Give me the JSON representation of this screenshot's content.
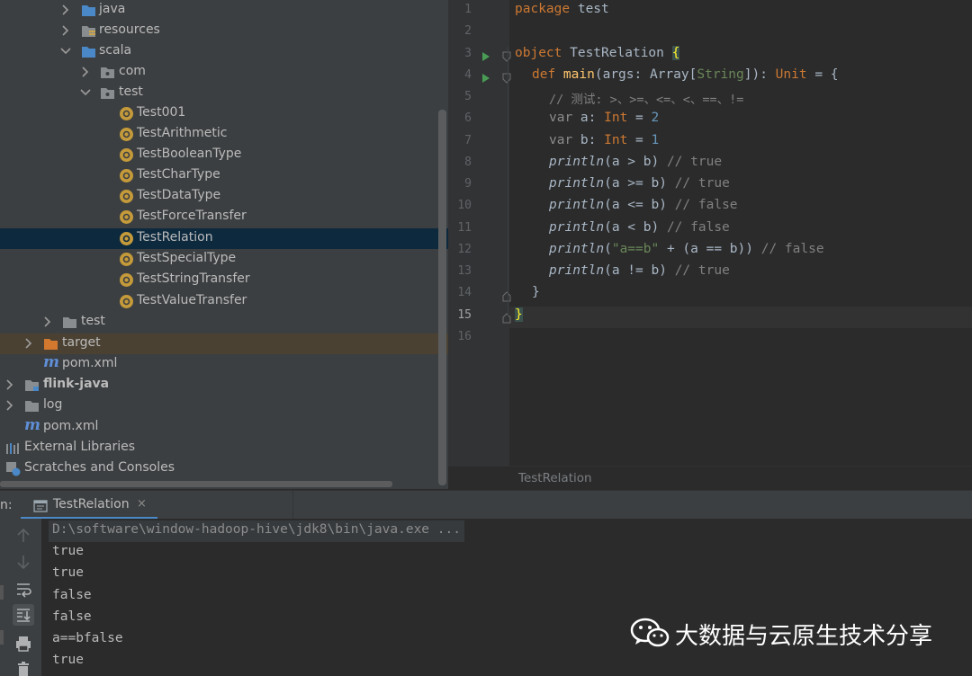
{
  "project_tree": {
    "items": [
      {
        "label": "java",
        "icon": "folder-icon"
      },
      {
        "label": "resources",
        "icon": "resources-folder-icon"
      },
      {
        "label": "scala",
        "icon": "source-folder-icon"
      },
      {
        "label": "com",
        "icon": "package-icon"
      },
      {
        "label": "test",
        "icon": "package-icon"
      },
      {
        "label": "Test001",
        "icon": "scala-object-icon"
      },
      {
        "label": "TestArithmetic",
        "icon": "scala-object-icon"
      },
      {
        "label": "TestBooleanType",
        "icon": "scala-object-icon"
      },
      {
        "label": "TestCharType",
        "icon": "scala-object-icon"
      },
      {
        "label": "TestDataType",
        "icon": "scala-object-icon"
      },
      {
        "label": "TestForceTransfer",
        "icon": "scala-object-icon"
      },
      {
        "label": "TestRelation",
        "icon": "scala-object-icon",
        "selected": true
      },
      {
        "label": "TestSpecialType",
        "icon": "scala-object-icon"
      },
      {
        "label": "TestStringTransfer",
        "icon": "scala-object-icon"
      },
      {
        "label": "TestValueTransfer",
        "icon": "scala-object-icon"
      },
      {
        "label": "test",
        "icon": "folder-icon"
      },
      {
        "label": "target",
        "icon": "excluded-folder-icon"
      },
      {
        "label": "pom.xml",
        "icon": "maven-icon",
        "glyph": "m"
      },
      {
        "label": "flink-java",
        "icon": "module-folder-icon"
      },
      {
        "label": "log",
        "icon": "folder-icon"
      },
      {
        "label": "pom.xml",
        "icon": "maven-icon",
        "glyph": "m"
      },
      {
        "label": "External Libraries",
        "icon": "libraries-icon"
      },
      {
        "label": "Scratches and Consoles",
        "icon": "scratches-icon"
      }
    ]
  },
  "editor": {
    "file_tab": "TestRelation",
    "current_line": "15",
    "line_numbers": [
      "1",
      "2",
      "3",
      "4",
      "5",
      "6",
      "7",
      "8",
      "9",
      "10",
      "11",
      "12",
      "13",
      "14",
      "15",
      "16"
    ],
    "code": {
      "l1_kw": "package",
      "l1_rest": " test",
      "l3_kw": "object",
      "l3_name": " TestRelation ",
      "l3_brace": "{",
      "l4_kw": "def",
      "l4_fn": " main",
      "l4_a": "(args: Array[",
      "l4_type": "String",
      "l4_b": "]): ",
      "l4_unit": "Unit",
      "l4_c": " = {",
      "l5_comment": "// 测试: >、>=、<=、<、==、!=",
      "l6_kw": "var",
      "l6_a": " a: ",
      "l6_type": "Int",
      "l6_b": " = ",
      "l6_num": "2",
      "l7_kw": "var",
      "l7_a": " b: ",
      "l7_type": "Int",
      "l7_b": " = ",
      "l7_num": "1",
      "l8_fn": "println",
      "l8_rest": "(a > b) ",
      "l8_comment": "// true",
      "l9_fn": "println",
      "l9_rest": "(a >= b) ",
      "l9_comment": "// true",
      "l10_fn": "println",
      "l10_rest": "(a <= b) ",
      "l10_comment": "// false",
      "l11_fn": "println",
      "l11_rest": "(a < b) ",
      "l11_comment": "// false",
      "l12_fn": "println",
      "l12_a": "(",
      "l12_str": "\"a==b\"",
      "l12_b": " + (a == b)) ",
      "l12_comment": "// false",
      "l13_fn": "println",
      "l13_rest": "(a != b) ",
      "l13_comment": "// true",
      "l14": "}",
      "l15": "}"
    }
  },
  "run_panel": {
    "prefix": "n:",
    "tab_label": "TestRelation",
    "close_glyph": "×",
    "command": "D:\\software\\window-hadoop-hive\\jdk8\\bin\\java.exe ...",
    "output": [
      "true",
      "true",
      "false",
      "false",
      "a==bfalse",
      "true"
    ],
    "toolbar": [
      "up-arrow-icon",
      "down-arrow-icon",
      "soft-wrap-icon",
      "scroll-to-end-icon",
      "print-icon",
      "trash-icon"
    ]
  },
  "watermark": {
    "text": "大数据与云原生技术分享",
    "icon": "wechat-icon"
  },
  "colors": {
    "tree_bg": "#3c3f41",
    "editor_bg": "#2b2b2b",
    "keyword": "#cc7832",
    "function": "#ffc66d",
    "number": "#6897bb",
    "string": "#6a8759",
    "comment": "#808080",
    "selection": "#0d293e",
    "accent": "#4a88c7"
  }
}
